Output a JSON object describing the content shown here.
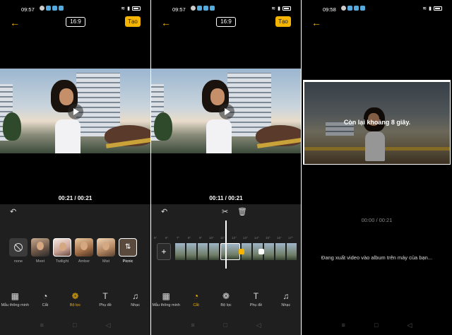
{
  "status": {
    "time1": "09:57",
    "time2": "09:57",
    "time3": "09:58"
  },
  "toolbar": {
    "ratio": "16:9",
    "create": "Tạo"
  },
  "panel1": {
    "timecode": "00:21 / 00:21",
    "filters": [
      {
        "label": "none"
      },
      {
        "label": "Meet"
      },
      {
        "label": "Twilight"
      },
      {
        "label": "Amber"
      },
      {
        "label": "Mist"
      },
      {
        "label": "Picnic",
        "selected": true
      }
    ]
  },
  "panel2": {
    "timecode": "00:11 / 00:21",
    "ruler": [
      "5\"",
      "6\"",
      "7\"",
      "8\"",
      "9\"",
      "10\"",
      "11\"",
      "12\"",
      "13\"",
      "14\"",
      "15\"",
      "16\"",
      "17\""
    ]
  },
  "nav": {
    "items": [
      {
        "label": "Mẫu thông minh",
        "icon": "grid-icon"
      },
      {
        "label": "Cắt",
        "icon": "palette-icon"
      },
      {
        "label": "Bộ lọc",
        "icon": "filter-icon"
      },
      {
        "label": "Phụ đề",
        "icon": "text-icon"
      },
      {
        "label": "Nhạc",
        "icon": "music-icon"
      }
    ],
    "active_panel1": "Bộ lọc",
    "active_panel2": "Cắt"
  },
  "panel3": {
    "remaining": "Còn lại khoảng 8 giây.",
    "timecode": "00:00 / 00:21",
    "message": "Đang xuất video vào album trên máy của bạn..."
  },
  "colors": {
    "accent": "#f5b400",
    "background": "#000000",
    "panel": "#1f1f1f"
  }
}
